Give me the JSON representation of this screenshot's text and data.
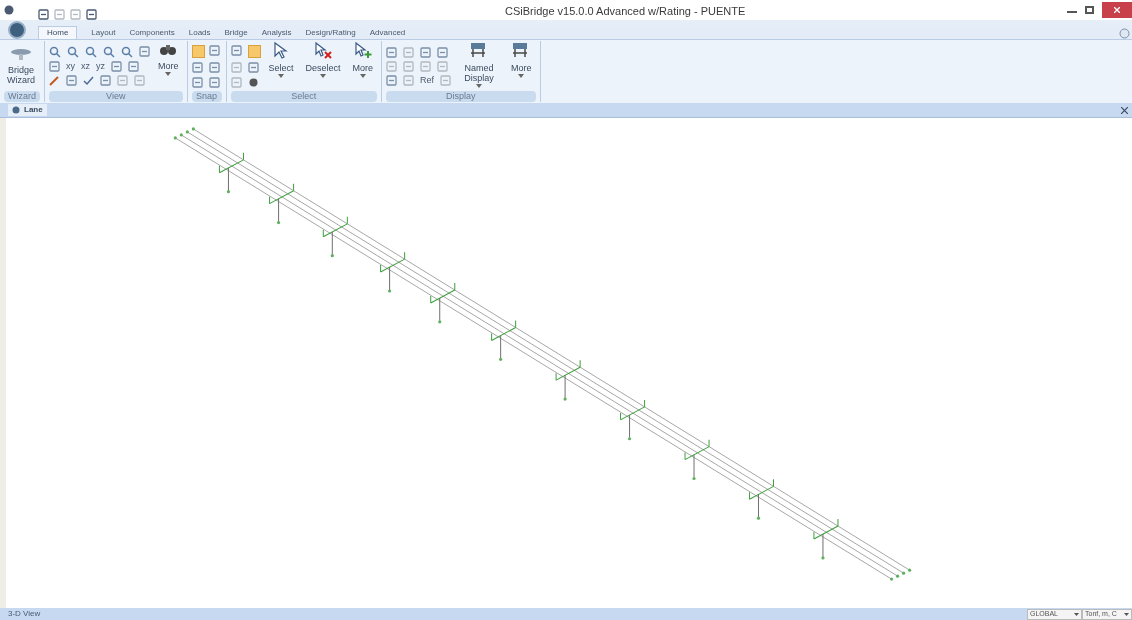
{
  "window": {
    "title": "CSiBridge v15.0.0 Advanced w/Rating  - PUENTE"
  },
  "tabs": [
    {
      "label": "Home",
      "selected": true
    },
    {
      "label": "Layout",
      "selected": false
    },
    {
      "label": "Components",
      "selected": false
    },
    {
      "label": "Loads",
      "selected": false
    },
    {
      "label": "Bridge",
      "selected": false
    },
    {
      "label": "Analysis",
      "selected": false
    },
    {
      "label": "Design/Rating",
      "selected": false
    },
    {
      "label": "Advanced",
      "selected": false
    }
  ],
  "ribbon": [
    {
      "label": "Wizard",
      "lead": "Bridge Wizard"
    },
    {
      "label": "View",
      "small": [
        "xy",
        "xz",
        "yz"
      ],
      "large": [
        "More"
      ]
    },
    {
      "label": "Snap"
    },
    {
      "label": "Select",
      "large": [
        "Select",
        "Deselect",
        "More"
      ]
    },
    {
      "label": "Display",
      "small": [
        "Ref"
      ],
      "large": [
        "Named Display",
        "More"
      ]
    }
  ],
  "document_tab": {
    "label": "Lane"
  },
  "status_bar": {
    "text": "3-D View",
    "coordinate_system": "GLOBAL",
    "units": "Tonf, m, C"
  }
}
